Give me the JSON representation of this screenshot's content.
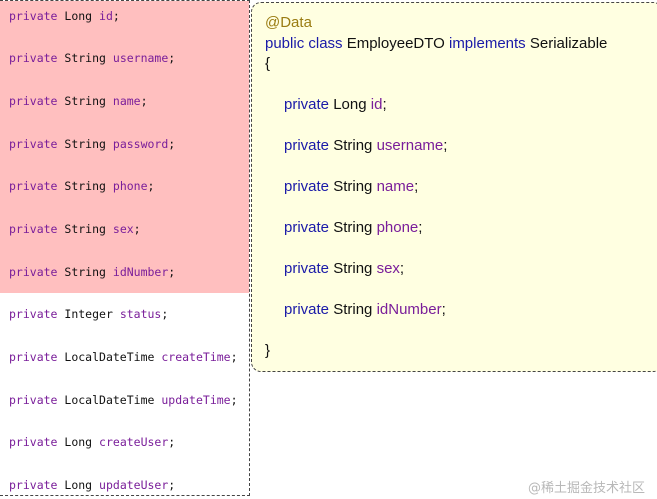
{
  "left_code": {
    "lines": [
      {
        "kw": "private",
        "type": "Long",
        "name": "id"
      },
      {
        "kw": "private",
        "type": "String",
        "name": "username"
      },
      {
        "kw": "private",
        "type": "String",
        "name": "name"
      },
      {
        "kw": "private",
        "type": "String",
        "name": "password"
      },
      {
        "kw": "private",
        "type": "String",
        "name": "phone"
      },
      {
        "kw": "private",
        "type": "String",
        "name": "sex"
      },
      {
        "kw": "private",
        "type": "String",
        "name": "idNumber"
      },
      {
        "kw": "private",
        "type": "Integer",
        "name": "status"
      },
      {
        "kw": "private",
        "type": "LocalDateTime",
        "name": "createTime"
      },
      {
        "kw": "private",
        "type": "LocalDateTime",
        "name": "updateTime"
      },
      {
        "kw": "private",
        "type": "Long",
        "name": "createUser"
      },
      {
        "kw": "private",
        "type": "Long",
        "name": "updateUser"
      }
    ]
  },
  "right_code": {
    "annotation": "@Data",
    "decl_public_class": "public class",
    "class_name": "EmployeeDTO",
    "implements_kw": "implements",
    "interface_name": "Serializable",
    "open_brace": "{",
    "close_brace": "}",
    "fields": [
      {
        "kw": "private",
        "type": "Long",
        "name": "id"
      },
      {
        "kw": "private",
        "type": "String",
        "name": "username"
      },
      {
        "kw": "private",
        "type": "String",
        "name": "name"
      },
      {
        "kw": "private",
        "type": "String",
        "name": "phone"
      },
      {
        "kw": "private",
        "type": "String",
        "name": "sex"
      },
      {
        "kw": "private",
        "type": "String",
        "name": "idNumber"
      }
    ]
  },
  "watermark": "@稀土掘金技术社区",
  "colors": {
    "highlight": "#ffbfbf",
    "note_bg": "#ffffe1",
    "keyword": "#7a1e9a",
    "annotation": "#9a7c12"
  }
}
